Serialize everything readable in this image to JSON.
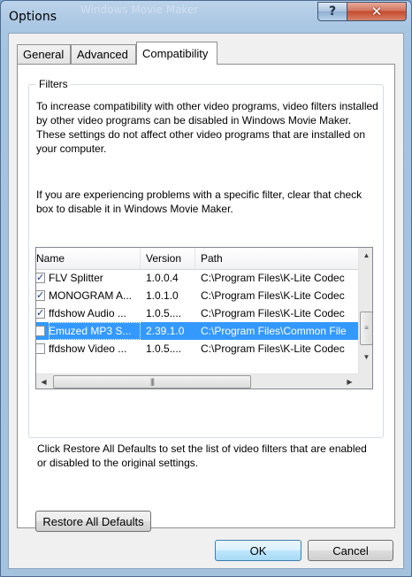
{
  "window": {
    "title": "Options",
    "background_title": "Windows Movie Maker",
    "help_glyph": "?",
    "close_glyph": "✕"
  },
  "tabs": [
    {
      "label": "General"
    },
    {
      "label": "Advanced"
    },
    {
      "label": "Compatibility"
    }
  ],
  "active_tab": "Compatibility",
  "filters": {
    "group_label": "Filters",
    "intro": "To increase compatibility with other video programs, video filters installed by other video programs can be disabled in Windows Movie Maker.  These settings do not affect other video programs that are installed on your computer.",
    "instructions": "If you are experiencing problems with a specific filter, clear that check box to disable it in Windows Movie Maker.",
    "columns": {
      "name": "Name",
      "version": "Version",
      "path": "Path"
    },
    "rows": [
      {
        "checked": true,
        "name": "FLV Splitter",
        "version": "1.0.0.4",
        "path": "C:\\Program Files\\K-Lite Codec",
        "selected": false
      },
      {
        "checked": true,
        "name": "MONOGRAM A...",
        "version": "1.0.1.0",
        "path": "C:\\Program Files\\K-Lite Codec",
        "selected": false
      },
      {
        "checked": true,
        "name": "ffdshow Audio ...",
        "version": "1.0.5....",
        "path": "C:\\Program Files\\K-Lite Codec",
        "selected": false
      },
      {
        "checked": false,
        "name": "Emuzed MP3 S...",
        "version": "2.39.1.0",
        "path": "C:\\Program Files\\Common File",
        "selected": true
      },
      {
        "checked": false,
        "name": "ffdshow Video ...",
        "version": "1.0.5....",
        "path": "C:\\Program Files\\K-Lite Codec",
        "selected": false
      }
    ]
  },
  "restore_note": "Click Restore All Defaults to set the list of video filters that are enabled or disabled to the original settings.",
  "buttons": {
    "restore": "Restore All Defaults",
    "ok": "OK",
    "cancel": "Cancel"
  },
  "icons": {
    "check": "✓",
    "scroll_up": "▲",
    "scroll_down": "▼",
    "scroll_left": "◀",
    "scroll_right": "▶",
    "grip_vertical": "≡",
    "grip_horizontal": "|||"
  }
}
